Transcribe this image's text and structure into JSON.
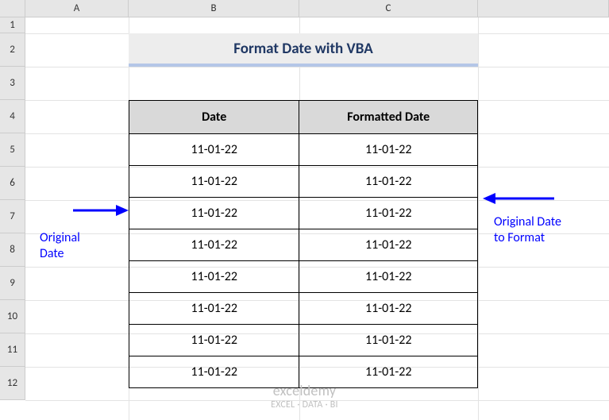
{
  "columns": [
    "A",
    "B",
    "C",
    ""
  ],
  "rows": [
    "1",
    "2",
    "3",
    "4",
    "5",
    "6",
    "7",
    "8",
    "9",
    "10",
    "11",
    "12"
  ],
  "title": "Format Date with VBA",
  "headers": {
    "b": "Date",
    "c": "Formatted Date"
  },
  "data": [
    {
      "date": "11-01-22",
      "formatted": "11-01-22"
    },
    {
      "date": "11-01-22",
      "formatted": "11-01-22"
    },
    {
      "date": "11-01-22",
      "formatted": "11-01-22"
    },
    {
      "date": "11-01-22",
      "formatted": "11-01-22"
    },
    {
      "date": "11-01-22",
      "formatted": "11-01-22"
    },
    {
      "date": "11-01-22",
      "formatted": "11-01-22"
    },
    {
      "date": "11-01-22",
      "formatted": "11-01-22"
    },
    {
      "date": "11-01-22",
      "formatted": "11-01-22"
    }
  ],
  "annotations": {
    "left_line1": "Original",
    "left_line2": "Date",
    "right_line1": "Original Date",
    "right_line2": "to Format"
  },
  "watermark": {
    "main": "exceldemy",
    "sub": "EXCEL · DATA · BI"
  }
}
